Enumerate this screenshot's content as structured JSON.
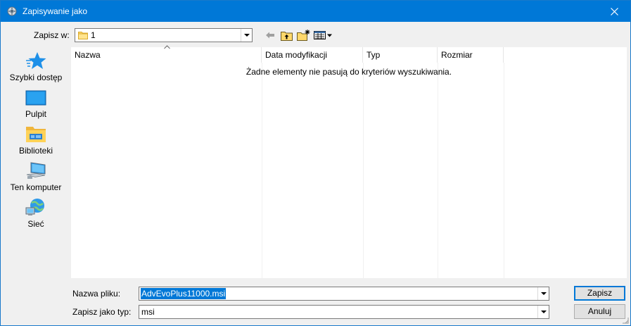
{
  "window": {
    "title": "Zapisywanie jako"
  },
  "location": {
    "label": "Zapisz w:",
    "value": "1"
  },
  "toolbar": {
    "icons": [
      "back-arrow-icon",
      "up-folder-icon",
      "new-folder-icon",
      "view-menu-icon"
    ]
  },
  "places": [
    {
      "label": "Szybki dostęp",
      "icon": "quick-access-star-icon"
    },
    {
      "label": "Pulpit",
      "icon": "desktop-icon"
    },
    {
      "label": "Biblioteki",
      "icon": "libraries-icon"
    },
    {
      "label": "Ten komputer",
      "icon": "computer-icon"
    },
    {
      "label": "Sieć",
      "icon": "network-icon"
    }
  ],
  "file_list": {
    "columns": [
      "Nazwa",
      "Data modyfikacji",
      "Typ",
      "Rozmiar"
    ],
    "empty_message": "Żadne elementy nie pasują do kryteriów wyszukiwania."
  },
  "filename": {
    "label": "Nazwa pliku:",
    "value": "AdvEvoPlus11000.msi"
  },
  "filetype": {
    "label": "Zapisz jako typ:",
    "value": "msi"
  },
  "buttons": {
    "save": "Zapisz",
    "cancel": "Anuluj"
  },
  "colors": {
    "accent": "#0078d7",
    "background": "#f0f0f0"
  }
}
